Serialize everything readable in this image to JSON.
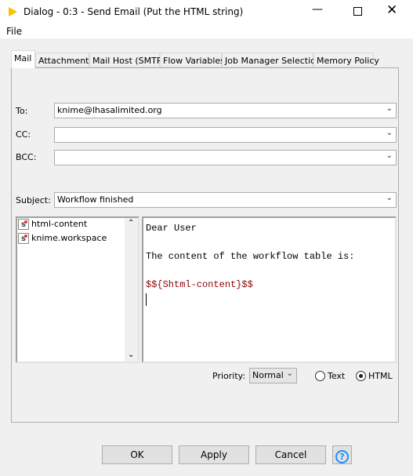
{
  "window": {
    "title": "Dialog - 0:3 - Send Email (Put the HTML string)"
  },
  "menu": {
    "file": "File"
  },
  "tabs": [
    {
      "label": "Mail"
    },
    {
      "label": "Attachments"
    },
    {
      "label": "Mail Host (SMTP)"
    },
    {
      "label": "Flow Variables"
    },
    {
      "label": "Job Manager Selection"
    },
    {
      "label": "Memory Policy"
    }
  ],
  "form": {
    "to_label": "To:",
    "to_value": "knime@lhasalimited.org",
    "cc_label": "CC:",
    "cc_value": "",
    "bcc_label": "BCC:",
    "bcc_value": "",
    "subject_label": "Subject:",
    "subject_value": "Workflow finished"
  },
  "variables": [
    {
      "label": "html-content",
      "icon": "string-variable-icon"
    },
    {
      "label": "knime.workspace",
      "icon": "string-variable-icon"
    }
  ],
  "body_lines": [
    "Dear User",
    "",
    "The content of the workflow table is:",
    "",
    "$${Shtml-content}$$"
  ],
  "body_link_color": "#8b0000",
  "priority": {
    "label": "Priority:",
    "value": "Normal"
  },
  "format": {
    "text_label": "Text",
    "html_label": "HTML",
    "selected": "HTML"
  },
  "buttons": {
    "ok": "OK",
    "apply": "Apply",
    "cancel": "Cancel",
    "help": "?"
  }
}
